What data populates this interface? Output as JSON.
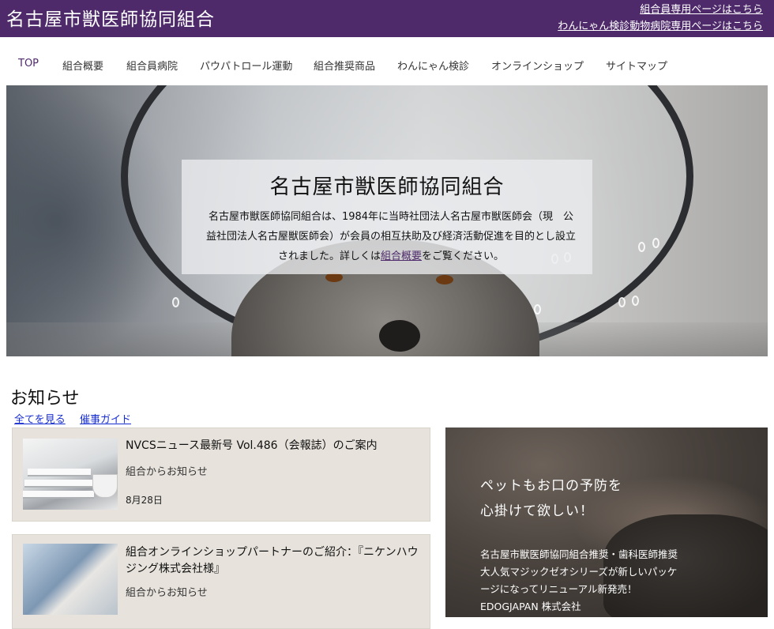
{
  "header": {
    "title": "名古屋市獣医師協同組合",
    "links": [
      "組合員専用ページはこちら",
      "わんにゃん検診動物病院専用ページはこちら"
    ]
  },
  "nav": {
    "items": [
      "TOP",
      "組合概要",
      "組合員病院",
      "パウパトロール運動",
      "組合推奨商品",
      "わんにゃん検診",
      "オンラインショップ",
      "サイトマップ"
    ],
    "active": "TOP"
  },
  "hero": {
    "title": "名古屋市獣医師協同組合",
    "text_before": "名古屋市獣医師協同組合は、1984年に当時社団法人名古屋市獣医師会（現　公益社団法人名古屋獣医師会）が会員の相互扶助及び経済活動促進を目的とし設立されました。詳しくは",
    "link": "組合概要",
    "text_after": "をご覧ください。"
  },
  "notices": {
    "title": "お知らせ",
    "links": [
      "全てを見る",
      "催事ガイド"
    ],
    "items": [
      {
        "title": "NVCSニュース最新号 Vol.486（会報誌）のご案内",
        "category": "組合からお知らせ",
        "date": "8月28日"
      },
      {
        "title": "組合オンラインショップパートナーのご紹介：『ニケンハウジング株式会社様』",
        "category": "組合からお知らせ"
      }
    ]
  },
  "promo": {
    "headline": [
      "ペットもお口の予防を",
      "心掛けて欲しい！"
    ],
    "body": [
      "名古屋市獣医師協同組合推奨・歯科医師推奨",
      "大人気マジックゼオシリーズが新しいパッケ",
      "ージになってリニューアル新発売！",
      "EDOGJAPAN 株式会社"
    ]
  },
  "colors": {
    "header_bg": "#4e2a6a",
    "card_bg": "#e7e3dc",
    "link": "#1a2fd0"
  },
  "icons": []
}
